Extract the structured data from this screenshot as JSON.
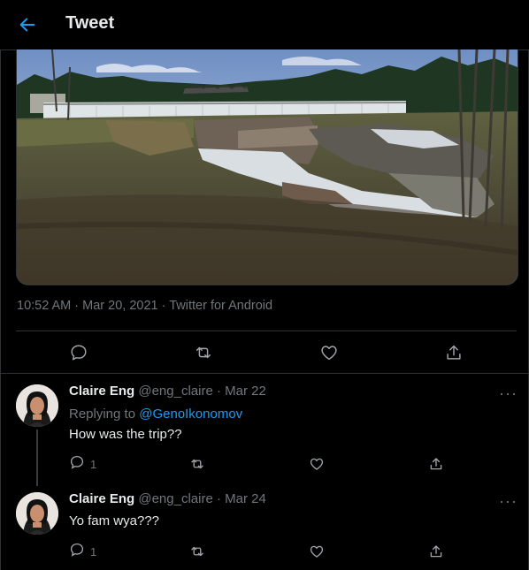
{
  "header": {
    "title": "Tweet"
  },
  "tweet": {
    "meta": "10:52 AM · Mar 20, 2021 · Twitter for Android"
  },
  "replies": [
    {
      "name": "Claire Eng",
      "handle": "@eng_claire",
      "date": "· Mar 22",
      "replying_label": "Replying to",
      "replying_to": "@GenoIkonomov",
      "text": "How was the trip??",
      "reply_count": "1"
    },
    {
      "name": "Claire Eng",
      "handle": "@eng_claire",
      "date": "· Mar 24",
      "text": "Yo fam wya???",
      "reply_count": "1"
    }
  ],
  "colors": {
    "accent": "#1d9bf0",
    "background": "#000000",
    "muted": "#71767b",
    "divider": "#2f3336"
  },
  "icons": [
    "back-arrow-icon",
    "reply-icon",
    "retweet-icon",
    "like-icon",
    "share-icon",
    "more-icon"
  ]
}
